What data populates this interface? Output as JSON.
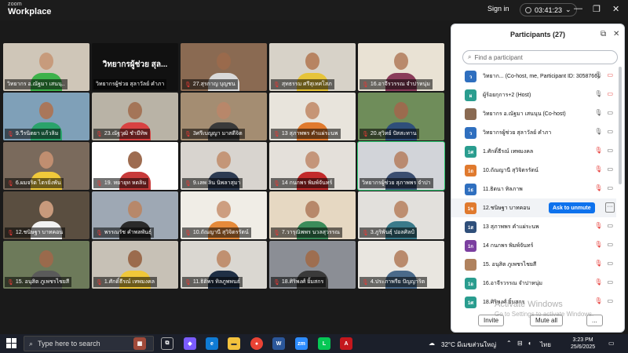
{
  "titlebar": {
    "brand_top": "zoom",
    "brand": "Workplace",
    "signin": "Sign in",
    "timer": "03:41:23"
  },
  "gallery": {
    "big_title": "วิทยากรผู้ช่วย สุล...",
    "tiles": [
      {
        "name": "วิทยากร อ.ณัฐมา เสนนุ..",
        "muted": false,
        "bg": "#cfc6b8",
        "skin": "#c79b7c",
        "shirt": "#3db24a"
      },
      {
        "name": "วิทยากรผู้ช่วย สุลาวัลย์ คำภา",
        "muted": false,
        "bg": "#111111",
        "skin": "",
        "shirt": ""
      },
      {
        "name": "27.สุรกาญ บุญชน",
        "muted": true,
        "bg": "#8a6a52",
        "skin": "#9a6a4c",
        "shirt": "#d9d9d9"
      },
      {
        "name": "สุทธรรม ศรีสุเทศโสภ",
        "muted": true,
        "bg": "#d7d2c8",
        "skin": "#b78462",
        "shirt": "#e6c43a"
      },
      {
        "name": "16.อาจีรวรรณ จำปาหนุ่ม",
        "muted": true,
        "bg": "#e9e2d4",
        "skin": "#b98a6c",
        "shirt": "#8a3c5a"
      },
      {
        "name": "9.วีรนิตยา แก้วลิม",
        "muted": true,
        "bg": "#7fa0b8",
        "skin": "#a9775b",
        "shirt": "#2aa36b"
      },
      {
        "name": "23.ณัฐวุฒิ ชำมีทิพ",
        "muted": true,
        "bg": "#b9b3a6",
        "skin": "#a47558",
        "shirt": "#d84242"
      },
      {
        "name": "3ศรีเบญญา มาสดีจิต",
        "muted": true,
        "bg": "#a48d72",
        "skin": "#b8876a",
        "shirt": "#3a3a3a"
      },
      {
        "name": "13 สุภาพพร คำแผ่ระนพ",
        "muted": true,
        "bg": "#e8e4dc",
        "skin": "#c69576",
        "shirt": "#e07a2e"
      },
      {
        "name": "20.สุวิทย์ ปัสสะทาน",
        "muted": true,
        "bg": "#6f8d5a",
        "skin": "#9b6b4e",
        "shirt": "#2f4f7a"
      },
      {
        "name": "6.ผมจริต ไตรยิ่งพัน",
        "muted": true,
        "bg": "#7a6a5c",
        "skin": "#c08e70",
        "shirt": "#f0c93a"
      },
      {
        "name": "19. ทยายุท หตลิน",
        "muted": true,
        "bg": "#ffffff",
        "skin": "#9e6c50",
        "shirt": "#c83a3a"
      },
      {
        "name": "9.เลพ ลิน นิพลาสุมา",
        "muted": true,
        "bg": "#d8d4cf",
        "skin": "#c49678",
        "shirt": "#2d3b52"
      },
      {
        "name": "14 กนกพร พิมพ์จันทร์",
        "muted": true,
        "bg": "#e4e0da",
        "skin": "#c4957a",
        "shirt": "#c22a2a"
      },
      {
        "name": "วิทยากรผู้ช่วย สุภาพพร จำปา",
        "muted": false,
        "bg": "#d2d4d9",
        "skin": "#b98a70",
        "shirt": "#3b4e70"
      },
      {
        "name": "12.ชนิษฐา บาทคอน",
        "muted": true,
        "bg": "#5a4e40",
        "skin": "#c89a7c",
        "shirt": "#f2f2f2"
      },
      {
        "name": "พรรณรัช คำพลพันธุ์",
        "muted": true,
        "bg": "#9ea8b4",
        "skin": "#b7886a",
        "shirt": "#2a2a2a"
      },
      {
        "name": "10.ถัณญานี สุวิจิตรรัตน์",
        "muted": true,
        "bg": "#f0ede6",
        "skin": "#cd9e80",
        "shirt": "#e58a3a"
      },
      {
        "name": "7.วารุณิพพร นวลสุวรรณ",
        "muted": true,
        "bg": "#e6d8c2",
        "skin": "#b7886a",
        "shirt": "#3b8c5a"
      },
      {
        "name": "3.ภูริพันธุ์ ปอลศิลป์",
        "muted": true,
        "bg": "#e2e0dc",
        "skin": "#bd8e70",
        "shirt": "#3a7a8a"
      },
      {
        "name": "15. อนุสิต ภูเพชรไชยสี",
        "muted": true,
        "bg": "#6d7a5a",
        "skin": "#9a6a4c",
        "shirt": "#5a5a5a"
      },
      {
        "name": "1.ศักดิ์ธีรณ์ เทพมงคล",
        "muted": true,
        "bg": "#c7c1b6",
        "skin": "#9b6b4d",
        "shirt": "#f0c83a"
      },
      {
        "name": "11.ธิติพร ทิลภูพพนธ์",
        "muted": true,
        "bg": "#dad7d1",
        "skin": "#c09070",
        "shirt": "#1f2f45"
      },
      {
        "name": "18.ศิริพงศ์ ยิ้มสกร",
        "muted": true,
        "bg": "#8b8e95",
        "skin": "#9e6e50",
        "shirt": "#3a3a3a"
      },
      {
        "name": "4.ประภาพรีย ปัญญาริต",
        "muted": true,
        "bg": "#e9e6e0",
        "skin": "#b98a6c",
        "shirt": "#4a6a8a"
      }
    ]
  },
  "participants": {
    "title": "Participants (27)",
    "search_placeholder": "Find a participant",
    "ask_to_unmute": "Ask to unmute",
    "rows": [
      {
        "initials": "ว",
        "color": "#2f6fbf",
        "name": "วิทยาก... (Co-host, me, Participant ID: 3058766)",
        "mic": "on",
        "cam": "off"
      },
      {
        "initials": "ผ",
        "color": "#2a9d8f",
        "name": "ผู้ร้อยกุการ+2 (Host)",
        "mic": "on",
        "cam": "off"
      },
      {
        "initials": "",
        "color": "#8a6a52",
        "name": "วิทยากร อ.ณัฐมา เสนนุน (Co-host)",
        "mic": "on",
        "cam": "on"
      },
      {
        "initials": "ว",
        "color": "#2f6fbf",
        "name": "วิทยากรผู้ช่วย สุลาวัลย์ คำภา",
        "mic": "on",
        "cam": "on"
      },
      {
        "initials": "1ศ",
        "color": "#2a9d8f",
        "name": "1.ศักดิ์ธีรณ์ เทพมงคล",
        "mic": "off",
        "cam": "on"
      },
      {
        "initials": "1ถ",
        "color": "#e07a2e",
        "name": "10.ถัณญานี สุวิจิตรรัตน์",
        "mic": "off",
        "cam": "on"
      },
      {
        "initials": "1ธ",
        "color": "#2f6fbf",
        "name": "11.ธิดนา ทิลภาพ",
        "mic": "off",
        "cam": "on"
      },
      {
        "initials": "1ช",
        "color": "#e07a2e",
        "name": "12.ชนิษฐา บาทคอน",
        "mic": "off",
        "cam": "on"
      },
      {
        "initials": "1ส",
        "color": "#2f4f7a",
        "name": "13 สุภาพพร คำแผ่ระนพ",
        "mic": "off",
        "cam": "on"
      },
      {
        "initials": "1ก",
        "color": "#7b3fa0",
        "name": "14 กนกพร พิมพ์จันทร์",
        "mic": "off",
        "cam": "on"
      },
      {
        "initials": "",
        "color": "#b0825e",
        "name": "15. อนุสิต ภูเพชรไชยสี",
        "mic": "off",
        "cam": "on"
      },
      {
        "initials": "1อ",
        "color": "#2a9d8f",
        "name": "16.อาจีรวรรณ จำปาหนุ่ม",
        "mic": "off",
        "cam": "on"
      },
      {
        "initials": "1ศ",
        "color": "#2a9d8f",
        "name": "18.ศิริพงศ์ ยิ้มสกร",
        "mic": "off",
        "cam": "on"
      }
    ],
    "invite": "Invite",
    "mute_all": "Mute all",
    "more": "..."
  },
  "watermark": {
    "line1": "Activate Windows",
    "line2": "Go to Settings to activate Windows."
  },
  "taskbar": {
    "search": "Type here to search",
    "weather": "32°C มีเมฆส่วนใหญ่",
    "lang": "ไทย",
    "time": "3:23 PM",
    "date": "25/6/2025"
  }
}
